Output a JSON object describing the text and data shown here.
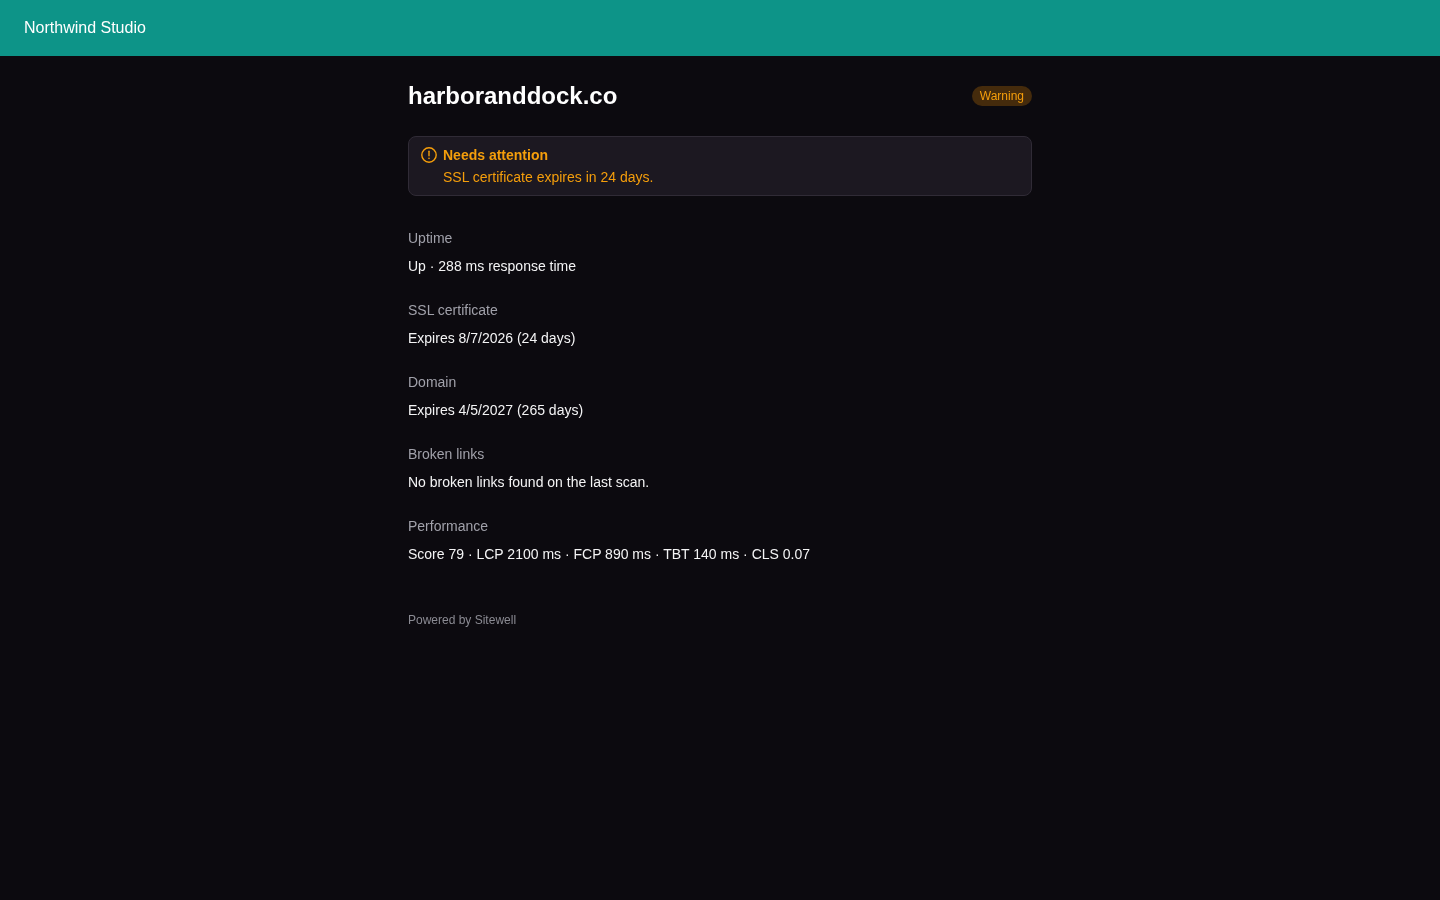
{
  "header": {
    "brand": "Northwind Studio"
  },
  "site": {
    "title": "harboranddock.co",
    "badge": {
      "label": "Warning",
      "kind": "warning"
    }
  },
  "alert": {
    "kind": "warning",
    "title": "Needs attention",
    "message": "SSL certificate expires in 24 days."
  },
  "sections": [
    {
      "label": "Uptime",
      "value": "Up · 288 ms response time"
    },
    {
      "label": "SSL certificate",
      "value": "Expires 8/7/2026 (24 days)"
    },
    {
      "label": "Domain",
      "value": "Expires 4/5/2027 (265 days)"
    },
    {
      "label": "Broken links",
      "value": "No broken links found on the last scan."
    },
    {
      "label": "Performance",
      "value": "Score 79 · LCP 2100 ms · FCP 890 ms · TBT 140 ms · CLS 0.07"
    }
  ],
  "footer": {
    "text": "Powered by Sitewell"
  }
}
